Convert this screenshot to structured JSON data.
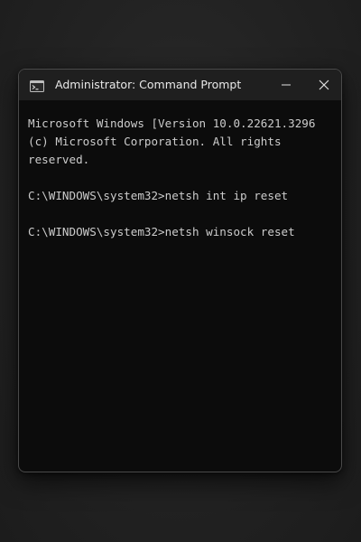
{
  "window": {
    "title": "Administrator: Command Prompt"
  },
  "icons": {
    "app": "command-prompt-icon",
    "minimize": "minimize-icon",
    "close": "close-icon"
  },
  "colors": {
    "console_background": "#0c0c0c",
    "console_text": "#cccccc",
    "titlebar_background": "#1f1f1f"
  },
  "console": {
    "lines": [
      "Microsoft Windows [Version 10.0.22621.3296",
      "(c) Microsoft Corporation. All rights",
      "reserved.",
      "",
      "C:\\WINDOWS\\system32>netsh int ip reset",
      "",
      "C:\\WINDOWS\\system32>netsh winsock reset"
    ]
  }
}
